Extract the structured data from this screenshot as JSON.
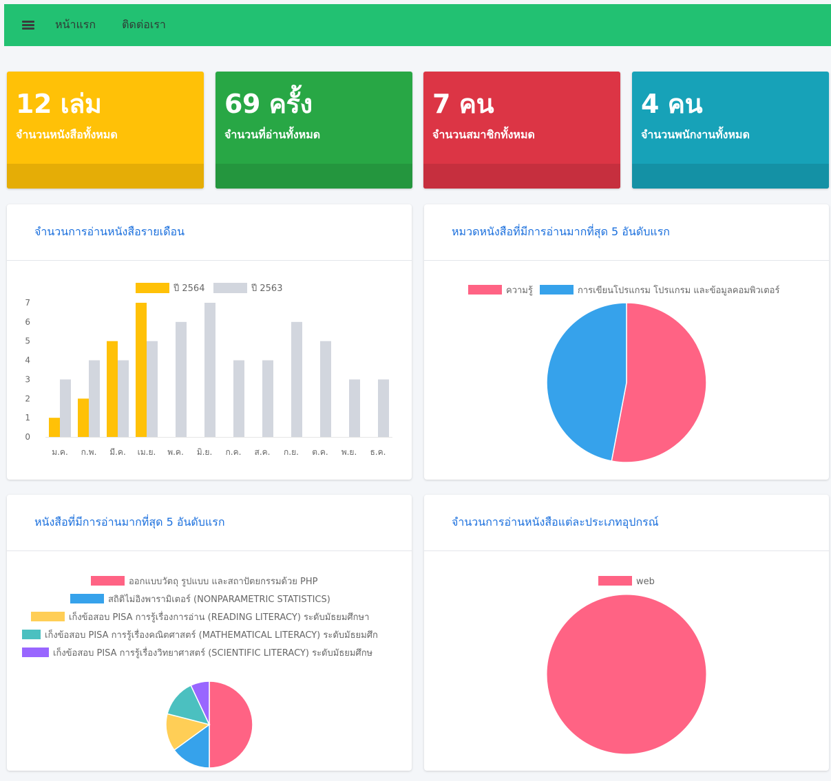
{
  "navbar": {
    "menu_icon": "hamburger-menu-icon",
    "links": [
      "หน้าแรก",
      "ติดต่อเรา"
    ],
    "color": "#22c172"
  },
  "stats": [
    {
      "value": "12 เล่ม",
      "label": "จำนวนหนังสือทั้งหมด",
      "color": "#ffc107",
      "foot_color": "#e5ad06"
    },
    {
      "value": "69 ครั้ง",
      "label": "จำนวนที่อ่านทั้งหมด",
      "color": "#28a745",
      "foot_color": "#24963e"
    },
    {
      "value": "7 คน",
      "label": "จำนวนสมาชิกทั้งหมด",
      "color": "#dc3545",
      "foot_color": "#c62f3e"
    },
    {
      "value": "4 คน",
      "label": "จำนวนพนักงานทั้งหมด",
      "color": "#17a2b8",
      "foot_color": "#1491a5"
    }
  ],
  "cards": {
    "monthly": {
      "title": "จำนวนการอ่านหนังสือรายเดือน"
    },
    "top_categories": {
      "title": "หมวดหนังสือที่มีการอ่านมากที่สุด 5 อันดับแรก"
    },
    "top_books": {
      "title": "หนังสือที่มีการอ่านมากที่สุด 5 อันดับแรก"
    },
    "devices": {
      "title": "จำนวนการอ่านหนังสือแต่ละประเภทอุปกรณ์"
    }
  },
  "chart_data": [
    {
      "id": "monthly",
      "type": "bar",
      "title": "จำนวนการอ่านหนังสือรายเดือน",
      "categories": [
        "ม.ค.",
        "ก.พ.",
        "มี.ค.",
        "เม.ย.",
        "พ.ค.",
        "มิ.ย.",
        "ก.ค.",
        "ส.ค.",
        "ก.ย.",
        "ต.ค.",
        "พ.ย.",
        "ธ.ค."
      ],
      "series": [
        {
          "name": "ปี 2564",
          "color": "#ffc107",
          "values": [
            1,
            2,
            5,
            7,
            0,
            0,
            0,
            0,
            0,
            0,
            0,
            0
          ]
        },
        {
          "name": "ปี 2563",
          "color": "#d2d6de",
          "values": [
            3,
            4,
            4,
            5,
            6,
            7,
            4,
            4,
            6,
            5,
            3,
            3
          ]
        }
      ],
      "yticks": [
        "0",
        "1",
        "2",
        "3",
        "4",
        "5",
        "6",
        "7"
      ],
      "ylim": [
        0,
        7
      ],
      "grid": false,
      "legend": "top"
    },
    {
      "id": "top_categories",
      "type": "pie",
      "title": "หมวดหนังสือที่มีการอ่านมากที่สุด 5 อันดับแรก",
      "labels": [
        "ความรู้",
        "การเขียนโปรแกรม โปรแกรม และข้อมูลคอมพิวเตอร์"
      ],
      "values": [
        53,
        47
      ],
      "colors": [
        "#ff6384",
        "#36a2eb"
      ],
      "legend": "top"
    },
    {
      "id": "top_books",
      "type": "pie",
      "title": "หนังสือที่มีการอ่านมากที่สุด 5 อันดับแรก",
      "labels": [
        "ออกแบบวัตถุ รูปแบบ และสถาปัตยกรรมด้วย PHP",
        "สถิติไม่อิงพารามิเตอร์ (NONPARAMETRIC STATISTICS)",
        "เก็งข้อสอบ PISA การรู้เรื่องการอ่าน (READING LITERACY) ระดับมัธยมศึกษา",
        "เก็งข้อสอบ PISA การรู้เรื่องคณิตศาสตร์ (MATHEMATICAL LITERACY) ระดับมัธยมศึก",
        "เก็งข้อสอบ PISA การรู้เรื่องวิทยาศาสตร์ (SCIENTIFIC LITERACY) ระดับมัธยมศึกษ"
      ],
      "values": [
        50,
        15,
        14,
        14,
        7
      ],
      "colors": [
        "#ff6384",
        "#36a2eb",
        "#ffce56",
        "#4bc0c0",
        "#9966ff"
      ],
      "legend": "top"
    },
    {
      "id": "devices",
      "type": "pie",
      "title": "จำนวนการอ่านหนังสือแต่ละประเภทอุปกรณ์",
      "labels": [
        "web"
      ],
      "values": [
        100
      ],
      "colors": [
        "#ff6384"
      ],
      "legend": "top"
    }
  ]
}
